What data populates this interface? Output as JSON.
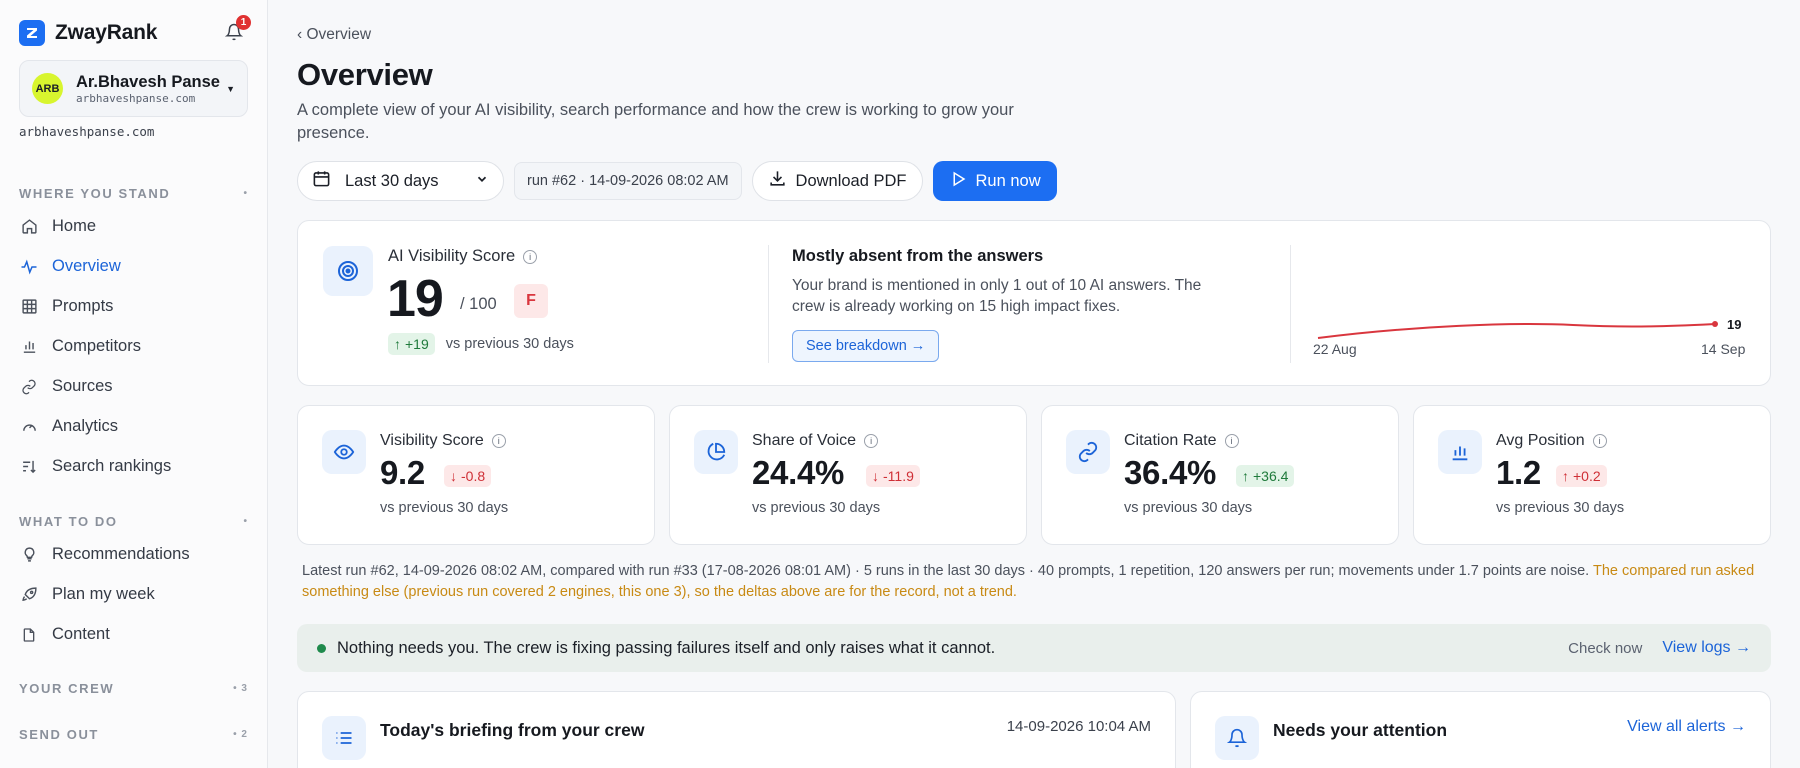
{
  "app": {
    "name": "ZwayRank",
    "notifications": "1"
  },
  "account": {
    "initials": "ARB",
    "name": "Ar.Bhavesh Panse",
    "domain": "arbhaveshpanse.com",
    "site": "arbhaveshpanse.com"
  },
  "sidebar": {
    "sections": [
      {
        "label": "WHERE YOU STAND",
        "meta": "•"
      },
      {
        "label": "WHAT TO DO",
        "meta": "•"
      },
      {
        "label": "YOUR CREW",
        "meta": "• 3"
      },
      {
        "label": "SEND OUT",
        "meta": "• 2"
      }
    ],
    "items": [
      {
        "label": "Home",
        "icon": "home-icon"
      },
      {
        "label": "Overview",
        "icon": "activity-icon",
        "active": true
      },
      {
        "label": "Prompts",
        "icon": "grid-icon"
      },
      {
        "label": "Competitors",
        "icon": "bar-chart-icon"
      },
      {
        "label": "Sources",
        "icon": "link-icon"
      },
      {
        "label": "Analytics",
        "icon": "gauge-icon"
      },
      {
        "label": "Search rankings",
        "icon": "sort-icon"
      },
      {
        "label": "Recommendations",
        "icon": "lightbulb-icon"
      },
      {
        "label": "Plan my week",
        "icon": "rocket-icon"
      },
      {
        "label": "Content",
        "icon": "document-icon"
      }
    ]
  },
  "header": {
    "breadcrumb": "‹ Overview",
    "title": "Overview",
    "subtitle": "A complete view of your AI visibility, search performance and how the crew is working to grow your presence."
  },
  "toolbar": {
    "date_range": "Last 30 days",
    "run": "run #62 · 14-09-2026 08:02 AM",
    "download_label": "Download PDF",
    "run_label": "Run now"
  },
  "hero": {
    "label": "AI Visibility Score",
    "score": "19",
    "max": "/ 100",
    "grade": "F",
    "delta": "+19",
    "delta_caption": "vs previous 30 days",
    "message_title": "Mostly absent from the answers",
    "message": "Your brand is mentioned in only 1 out of 10 AI answers. The crew is already working on 15 high impact fixes.",
    "breakdown_label": "See breakdown →",
    "trend_start": "22 Aug",
    "trend_end": "14 Sep",
    "trend_last": "19"
  },
  "metrics": [
    {
      "label": "Visibility Score",
      "value": "9.2",
      "delta": "-0.8",
      "dir": "down",
      "caption": "vs previous 30 days",
      "icon": "eye-icon"
    },
    {
      "label": "Share of Voice",
      "value": "24.4%",
      "delta": "-11.9",
      "dir": "down",
      "caption": "vs previous 30 days",
      "icon": "pie-chart-icon"
    },
    {
      "label": "Citation Rate",
      "value": "36.4%",
      "delta": "+36.4",
      "dir": "up",
      "caption": "vs previous 30 days",
      "icon": "link-icon"
    },
    {
      "label": "Avg Position",
      "value": "1.2",
      "delta": "+0.2",
      "dir": "down",
      "caption": "vs previous 30 days",
      "icon": "bar-chart-icon"
    }
  ],
  "note": {
    "main": "Latest run #62, 14-09-2026 08:02 AM, compared with run #33 (17-08-2026 08:01 AM) · 5 runs in the last 30 days · 40 prompts, 1 repetition, 120 answers per run; movements under 1.7 points are noise. ",
    "warning": "The compared run asked something else (previous run covered 2 engines, this one 3), so the deltas above are for the record, not a trend."
  },
  "status": {
    "text": "Nothing needs you. The crew is fixing passing failures itself and only raises what it cannot.",
    "check": "Check now",
    "logs": "View logs →"
  },
  "briefing": {
    "title": "Today's briefing from your crew",
    "time": "14-09-2026 10:04 AM"
  },
  "attention": {
    "title": "Needs your attention",
    "link": "View all alerts →"
  }
}
